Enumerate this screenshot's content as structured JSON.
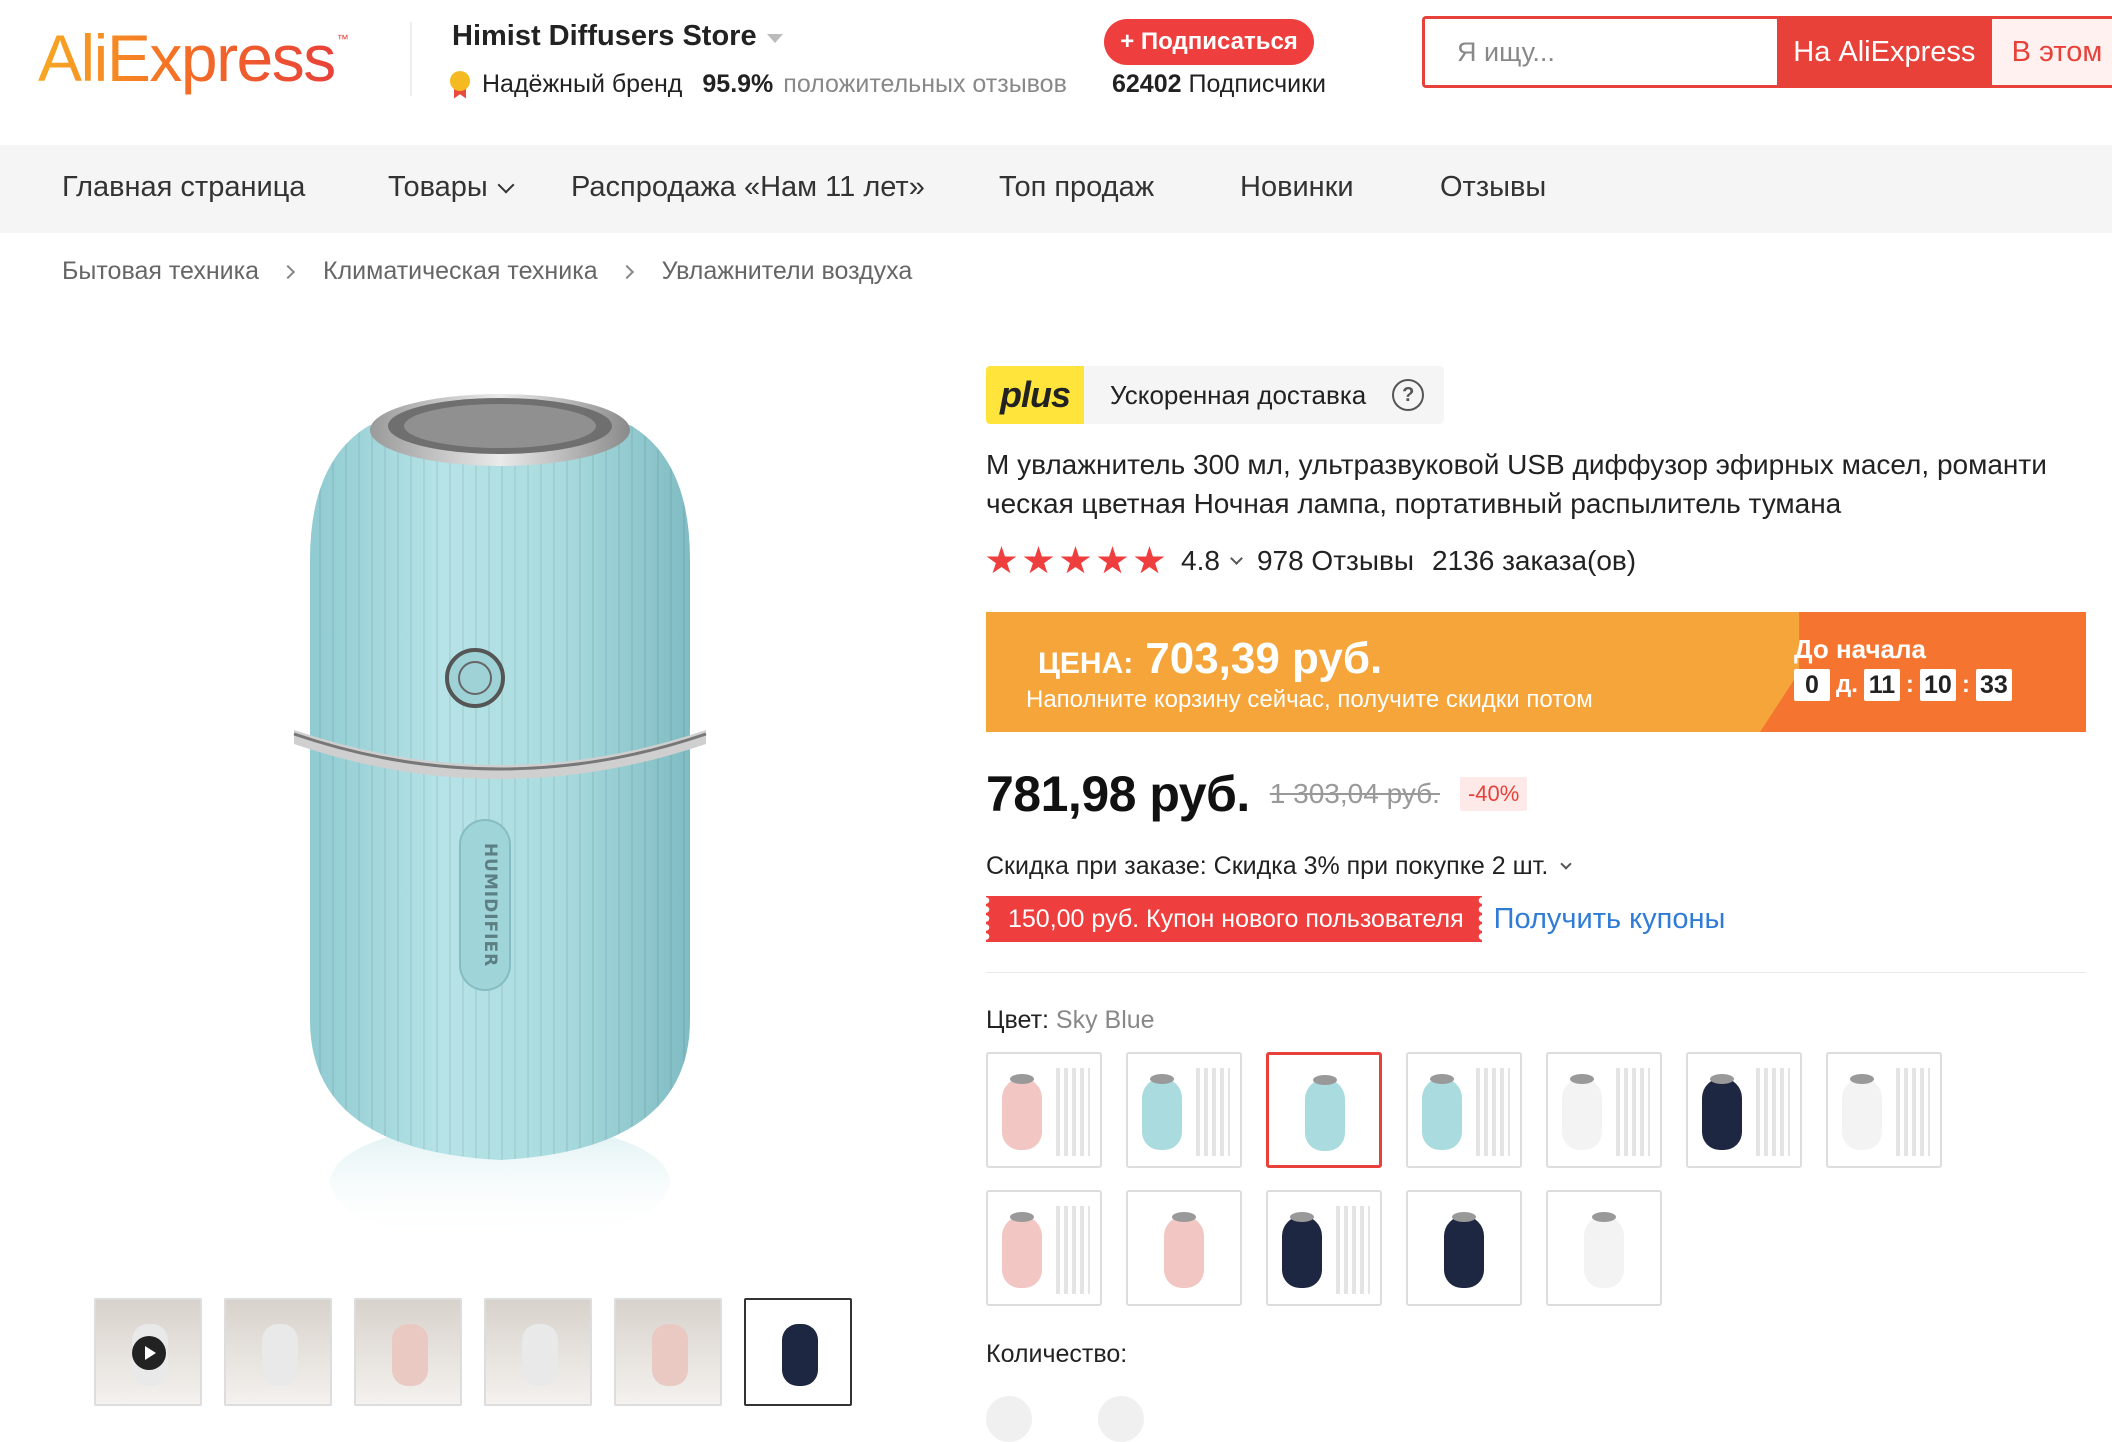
{
  "header": {
    "logo_text": "AliExpress",
    "logo_tm": "™",
    "store_name": "Himist Diffusers Store",
    "brand_badge": "Надёжный бренд",
    "positive_pct": "95.9%",
    "positive_text": "положительных отзывов",
    "subscribe_label": "+ Подписаться",
    "subscribers_count": "62402",
    "subscribers_label": "Подписчики",
    "search_placeholder": "Я ищу...",
    "search_ali_label": "На AliExpress",
    "search_store_label": "В этом"
  },
  "nav": {
    "items": [
      {
        "label": "Главная страница"
      },
      {
        "label": "Товары"
      },
      {
        "label": "Распродажа «Нам 11 лет»"
      },
      {
        "label": "Топ продаж"
      },
      {
        "label": "Новинки"
      },
      {
        "label": "Отзывы"
      }
    ]
  },
  "breadcrumb": [
    "Бытовая техника",
    "Климатическая техника",
    "Увлажнители воздуха"
  ],
  "product": {
    "main_image_text": "HUMIDIFIER",
    "plus_logo": "plus",
    "plus_text": "Ускоренная доставка",
    "help_symbol": "?",
    "title": "М увлажнитель 300 мл, ультразвуковой USB диффузор эфирных масел, романти ческая цветная Ночная лампа, портативный распылитель тумана",
    "rating": "4.8",
    "reviews": "978 Отзывы",
    "orders": "2136 заказа(ов)",
    "banner": {
      "price_label": "ЦЕНА:",
      "price_value": "703,39 руб.",
      "subtitle": "Наполните корзину сейчас, получите скидки потом",
      "timer_title": "До начала",
      "days": "0",
      "days_unit": "д.",
      "hours": "11",
      "minutes": "10",
      "seconds": "33",
      "sep": ":"
    },
    "price": "781,98 руб.",
    "old_price": "1 303,04 руб.",
    "discount": "-40%",
    "bulk_discount": "Скидка при заказе: Скидка 3% при покупке 2 шт.",
    "coupon": "150,00 руб. Купон нового пользователя",
    "coupon_link": "Получить купоны",
    "color_label": "Цвет:",
    "color_selected": "Sky Blue",
    "quantity_label": "Количество:"
  },
  "colors": {
    "pink": "#f2c6c2",
    "blue": "#a9dbdf",
    "white": "#f3f3f3",
    "navy": "#1e2741",
    "accent": "#e8413a",
    "link": "#2f7bd6"
  },
  "swatches": [
    {
      "color": "pink",
      "sticks": true
    },
    {
      "color": "blue",
      "sticks": true
    },
    {
      "color": "blue",
      "sticks": false,
      "selected": true
    },
    {
      "color": "blue",
      "sticks": true
    },
    {
      "color": "white",
      "sticks": true
    },
    {
      "color": "navy",
      "sticks": true
    },
    {
      "color": "white",
      "sticks": true
    },
    {
      "color": "pink",
      "sticks": true
    },
    {
      "color": "pink",
      "sticks": false
    },
    {
      "color": "navy",
      "sticks": true
    },
    {
      "color": "navy",
      "sticks": false
    },
    {
      "color": "white",
      "sticks": false
    }
  ],
  "thumbnails": [
    {
      "kind": "video",
      "tone": "white"
    },
    {
      "kind": "image",
      "tone": "white"
    },
    {
      "kind": "image",
      "tone": "pink"
    },
    {
      "kind": "image",
      "tone": "white"
    },
    {
      "kind": "image",
      "tone": "pink"
    },
    {
      "kind": "image",
      "tone": "navy"
    }
  ]
}
